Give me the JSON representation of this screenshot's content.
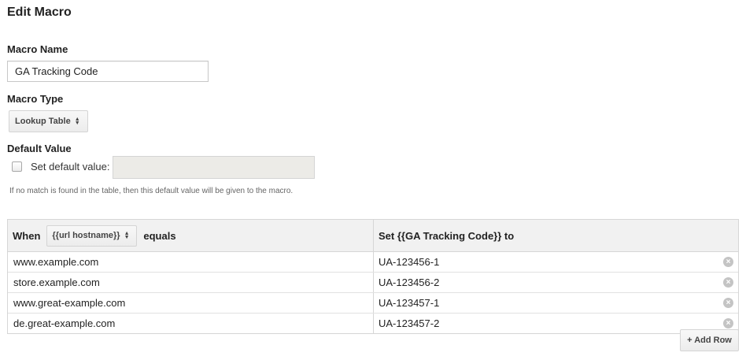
{
  "header": {
    "title": "Edit Macro"
  },
  "macro_name": {
    "label": "Macro Name",
    "value": "GA Tracking Code"
  },
  "macro_type": {
    "label": "Macro Type",
    "selected": "Lookup Table"
  },
  "default_value": {
    "label": "Default Value",
    "checkbox_label": "Set default value:",
    "checked": false,
    "input_value": "",
    "help_text": "If no match is found in the table, then this default value will be given to the macro."
  },
  "lookup_table": {
    "when_label": "When",
    "variable_selected": "{{url hostname}}",
    "equals_label": "equals",
    "set_label": "Set {{GA Tracking Code}} to",
    "rows": [
      {
        "when": "www.example.com",
        "set": "UA-123456-1"
      },
      {
        "when": "store.example.com",
        "set": "UA-123456-2"
      },
      {
        "when": "www.great-example.com",
        "set": "UA-123457-1"
      },
      {
        "when": "de.great-example.com",
        "set": "UA-123457-2"
      }
    ],
    "add_row_label": "+ Add Row"
  },
  "icons": {
    "remove": "remove-circle-icon",
    "select_arrows": "updown-arrows-icon"
  }
}
